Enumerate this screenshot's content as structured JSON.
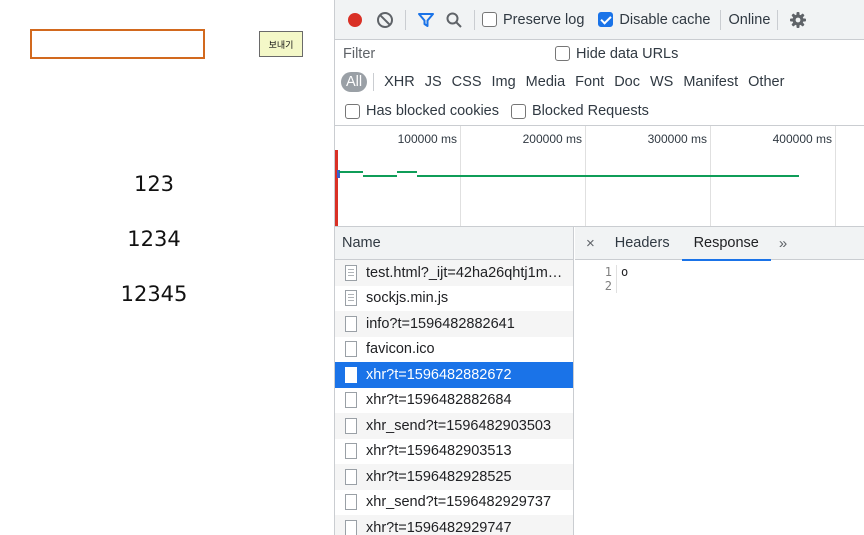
{
  "page": {
    "send_label": "보내기",
    "messages": [
      "123",
      "1234",
      "12345"
    ]
  },
  "devtools": {
    "toolbar": {
      "preserve_log": "Preserve log",
      "disable_cache": "Disable cache",
      "throttling": "Online"
    },
    "filter_placeholder": "Filter",
    "hide_data_urls": "Hide data URLs",
    "resource_types": [
      "All",
      "XHR",
      "JS",
      "CSS",
      "Img",
      "Media",
      "Font",
      "Doc",
      "WS",
      "Manifest",
      "Other"
    ],
    "has_blocked_cookies": "Has blocked cookies",
    "blocked_requests": "Blocked Requests",
    "overview_ticks": [
      "100000 ms",
      "200000 ms",
      "300000 ms",
      "400000 ms"
    ],
    "name_header": "Name",
    "requests": [
      "test.html?_ijt=42ha26qhtj1m…",
      "sockjs.min.js",
      "info?t=1596482882641",
      "favicon.ico",
      "xhr?t=1596482882672",
      "xhr?t=1596482882684",
      "xhr_send?t=1596482903503",
      "xhr?t=1596482903513",
      "xhr?t=1596482928525",
      "xhr_send?t=1596482929737",
      "xhr?t=1596482929747"
    ],
    "detail_tabs": {
      "close": "×",
      "headers": "Headers",
      "response": "Response",
      "more": "»"
    },
    "response": {
      "line_numbers": [
        "1",
        "2"
      ],
      "lines": [
        "o",
        ""
      ]
    },
    "colors": {
      "record": "#d93025",
      "accent": "#1a73e8",
      "timeline_bar": "#0f9d58"
    }
  }
}
